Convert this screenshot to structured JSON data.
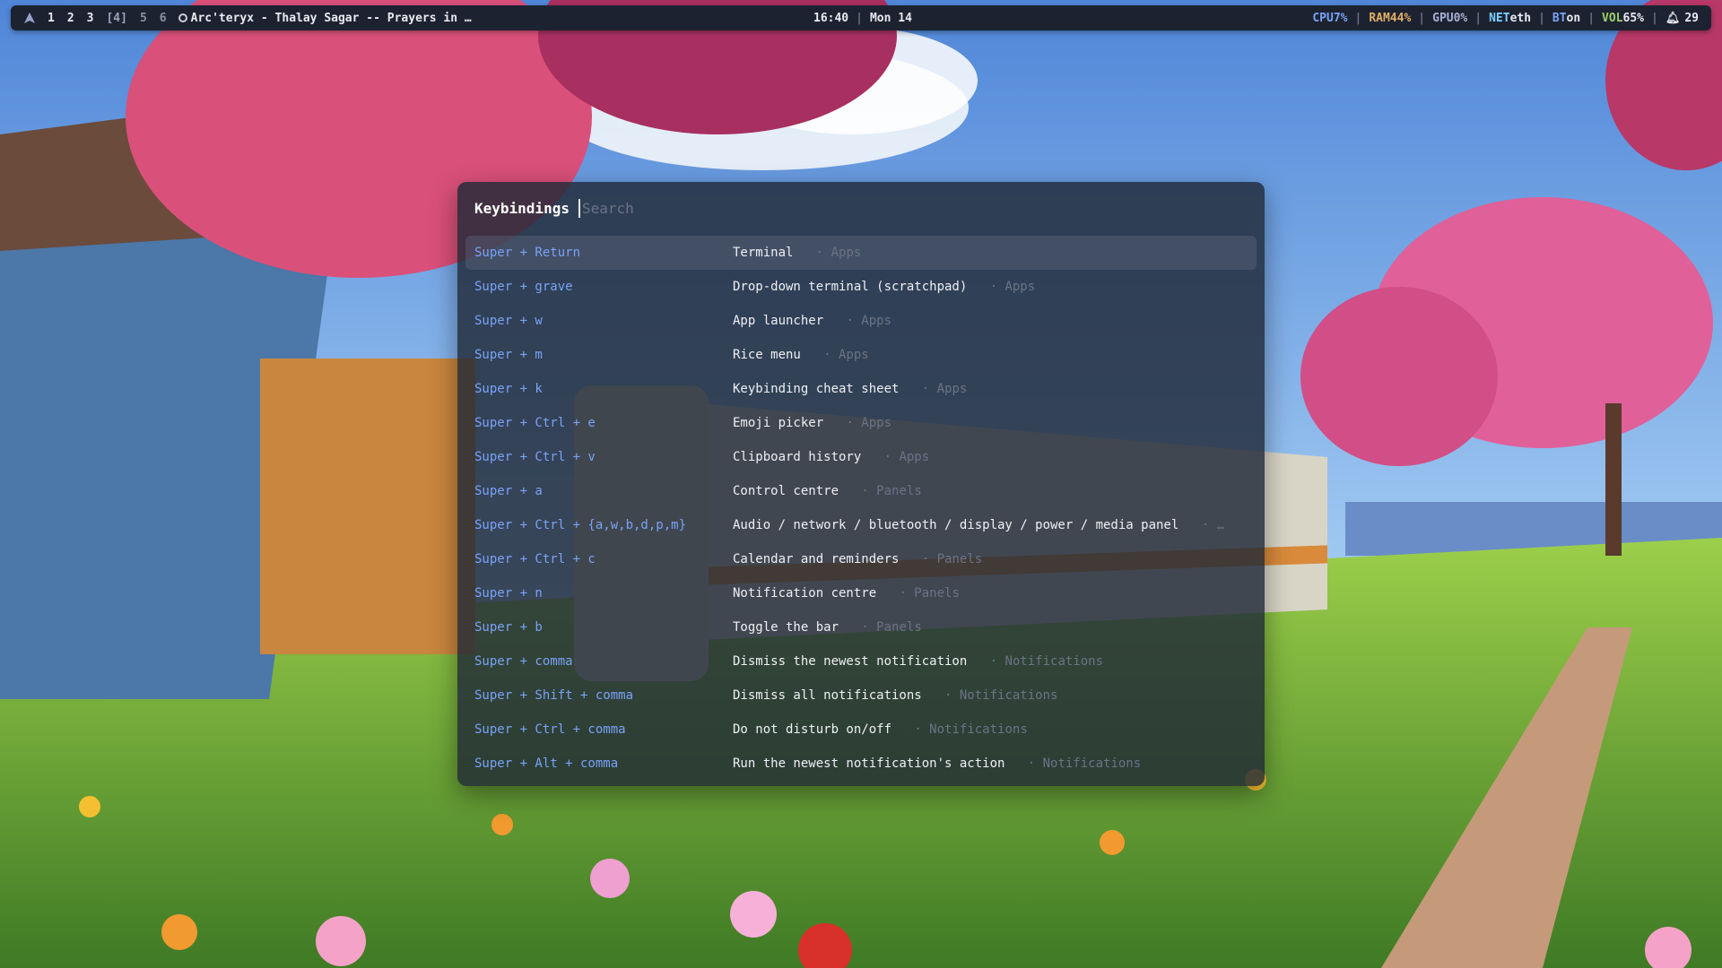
{
  "topbar": {
    "workspaces": [
      "1",
      "2",
      "3",
      "[4]",
      "5",
      "6"
    ],
    "window_title": "Arc'teryx - Thalay Sagar -- Prayers in …",
    "time": "16:40",
    "date": "Mon 14",
    "cpu_label": "CPU",
    "cpu_value": "7%",
    "ram_label": "RAM",
    "ram_value": "44%",
    "gpu_label": "GPU",
    "gpu_value": "0%",
    "net_label": "NET",
    "net_value": "eth",
    "bt_label": "BT",
    "bt_value": "on",
    "vol_label": "VOL",
    "vol_value": "65%",
    "notifications": "29"
  },
  "panel": {
    "title": "Keybindings",
    "search_placeholder": "Search",
    "rows": [
      {
        "keys": "Super + Return",
        "desc": "Terminal",
        "cat": "· Apps"
      },
      {
        "keys": "Super + grave",
        "desc": "Drop-down terminal (scratchpad)",
        "cat": "· Apps"
      },
      {
        "keys": "Super + w",
        "desc": "App launcher",
        "cat": "· Apps"
      },
      {
        "keys": "Super + m",
        "desc": "Rice menu",
        "cat": "· Apps"
      },
      {
        "keys": "Super + k",
        "desc": "Keybinding cheat sheet",
        "cat": "· Apps"
      },
      {
        "keys": "Super + Ctrl + e",
        "desc": "Emoji picker",
        "cat": "· Apps"
      },
      {
        "keys": "Super + Ctrl + v",
        "desc": "Clipboard history",
        "cat": "· Apps"
      },
      {
        "keys": "Super + a",
        "desc": "Control centre",
        "cat": "· Panels"
      },
      {
        "keys": "Super + Ctrl + {a,w,b,d,p,m}",
        "desc": "Audio / network / bluetooth / display / power / media panel",
        "cat": "· …"
      },
      {
        "keys": "Super + Ctrl + c",
        "desc": "Calendar and reminders",
        "cat": "· Panels"
      },
      {
        "keys": "Super + n",
        "desc": "Notification centre",
        "cat": "· Panels"
      },
      {
        "keys": "Super + b",
        "desc": "Toggle the bar",
        "cat": "· Panels"
      },
      {
        "keys": "Super + comma",
        "desc": "Dismiss the newest notification",
        "cat": "· Notifications"
      },
      {
        "keys": "Super + Shift + comma",
        "desc": "Dismiss all notifications",
        "cat": "· Notifications"
      },
      {
        "keys": "Super + Ctrl + comma",
        "desc": "Do not disturb on/off",
        "cat": "· Notifications"
      },
      {
        "keys": "Super + Alt + comma",
        "desc": "Run the newest notification's action",
        "cat": "· Notifications"
      }
    ]
  },
  "colors": {
    "bar_bg": "#1d2230",
    "panel_bg": "rgba(32,40,54,0.82)",
    "key_blue": "#7aa2f7",
    "category_gray": "#6b7385"
  }
}
